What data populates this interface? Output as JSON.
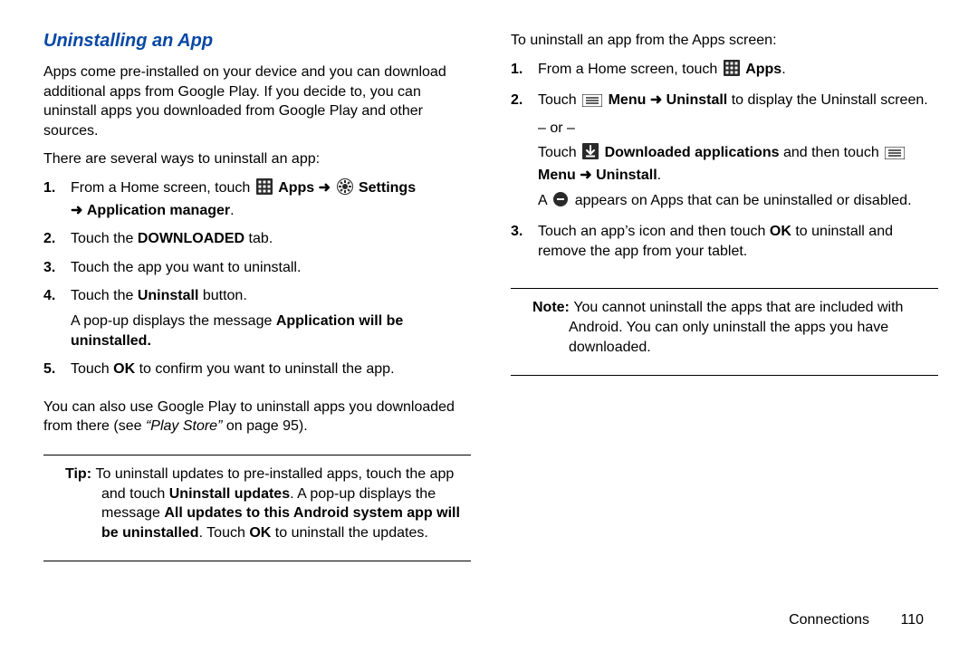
{
  "heading": "Uninstalling an App",
  "left": {
    "intro": "Apps come pre-installed on your device and you can download additional apps from Google Play. If you decide to, you can uninstall apps you downloaded from Google Play and other sources.",
    "lead": "There are several ways to uninstall an app:",
    "steps": {
      "s1a": "From a Home screen, touch ",
      "s1_apps": " Apps ",
      "s1_settings": " Settings ",
      "s1b": " Application manager",
      "s2a": "Touch the ",
      "s2b": "DOWNLOADED",
      "s2c": " tab.",
      "s3": "Touch the app you want to uninstall.",
      "s4a": "Touch the ",
      "s4b": "Uninstall",
      "s4c": " button.",
      "s4_suba": "A pop-up displays the message ",
      "s4_subb": "Application will be uninstalled.",
      "s5a": "Touch ",
      "s5b": "OK",
      "s5c": " to confirm you want to uninstall the app."
    },
    "after1a": "You can also use Google Play to uninstall apps you downloaded from there (see ",
    "after1b": "“Play Store”",
    "after1c": " on page 95).",
    "tip": {
      "label": "Tip: ",
      "a": "To uninstall updates to pre-installed apps, touch the app and touch ",
      "b": "Uninstall updates",
      "c": ". A pop-up displays the message ",
      "d": "All updates to this Android system app will be uninstalled",
      "e": ". Touch ",
      "f": "OK",
      "g": " to uninstall the updates."
    }
  },
  "right": {
    "lead": "To uninstall an app from the Apps screen:",
    "steps": {
      "s1a": "From a Home screen, touch ",
      "s1_apps": " Apps",
      "s2a": "Touch ",
      "s2_menu": " Menu ",
      "s2_uninstall": " Uninstall",
      "s2b": " to display the Uninstall screen.",
      "s2_or": "– or –",
      "s2c": "Touch ",
      "s2_dl": " Downloaded applications",
      "s2d": " and then touch ",
      "s2_menu2": " Menu ",
      "s2_uninstall2": " Uninstall",
      "s2e": ".",
      "s2f": "A ",
      "s2g": " appears on Apps that can be uninstalled or disabled.",
      "s3a": "Touch an app’s icon and then touch ",
      "s3b": "OK",
      "s3c": " to uninstall and remove the app from your tablet."
    },
    "note": {
      "label": "Note: ",
      "text": "You cannot uninstall the apps that are included with Android. You can only uninstall the apps you have downloaded."
    }
  },
  "footer": {
    "section": "Connections",
    "page": "110"
  },
  "arrow": "➜",
  "period": "."
}
